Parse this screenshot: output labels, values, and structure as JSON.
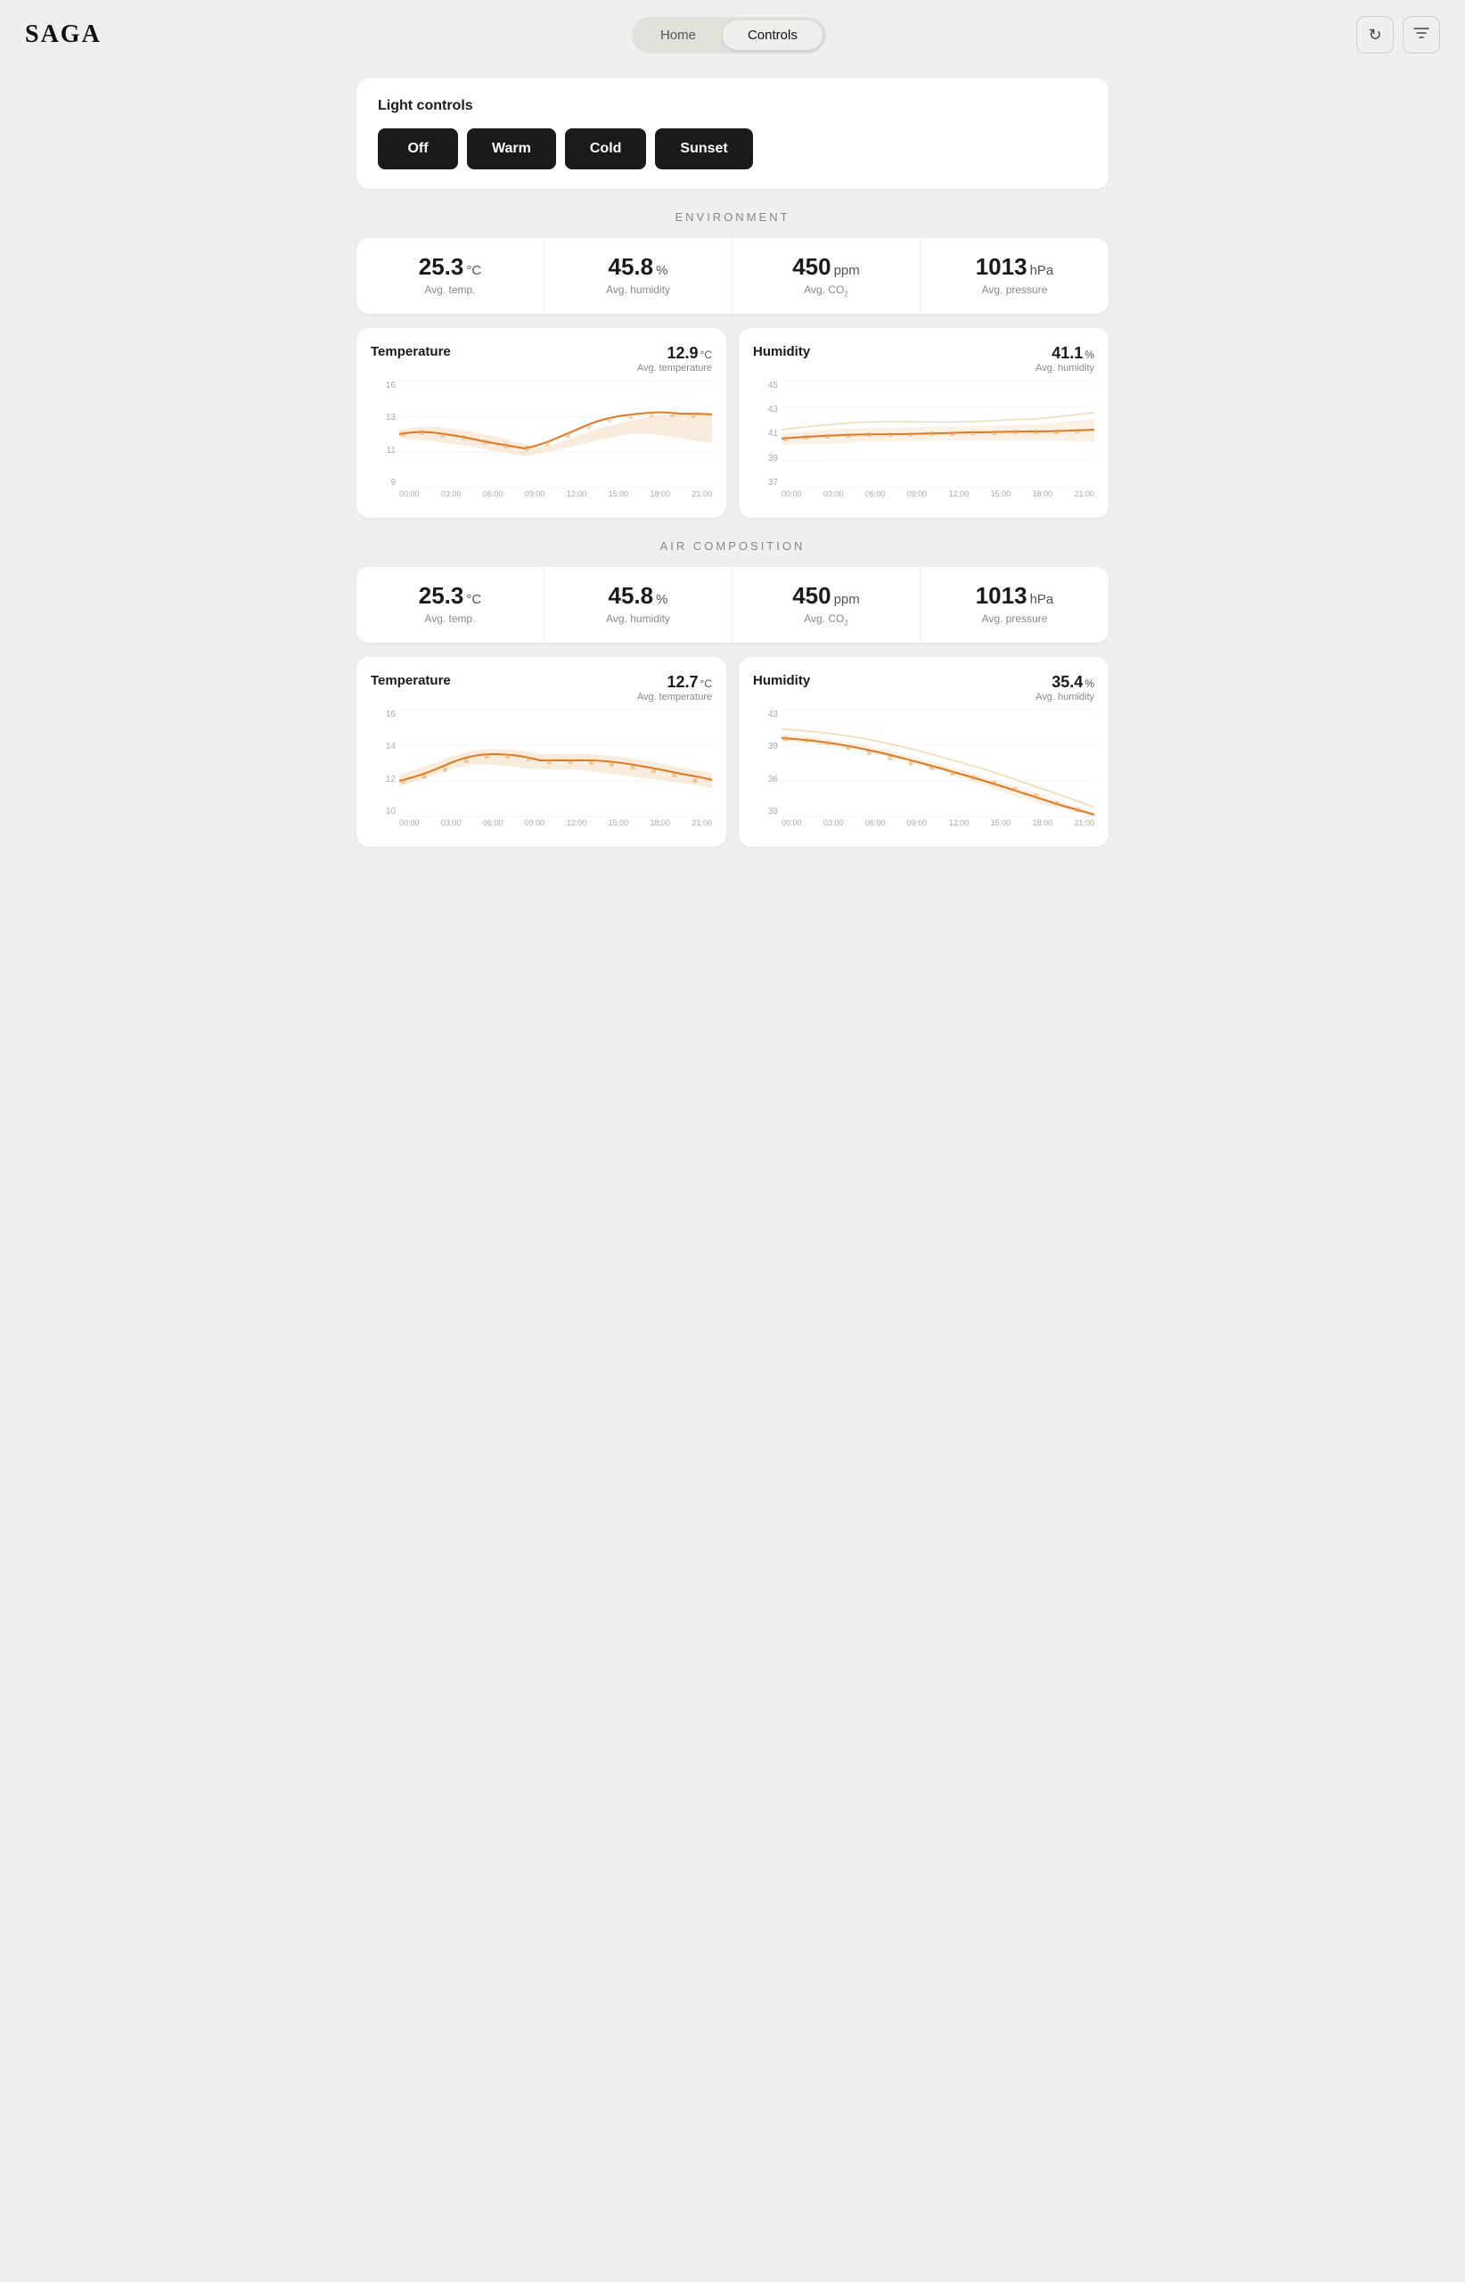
{
  "header": {
    "logo": "SAGA",
    "nav": {
      "home_label": "Home",
      "controls_label": "Controls"
    },
    "icons": {
      "refresh": "↻",
      "filter": "⚙"
    }
  },
  "light_controls": {
    "title": "Light controls",
    "buttons": [
      "Off",
      "Warm",
      "Cold",
      "Sunset"
    ]
  },
  "environment": {
    "section_title": "ENVIRONMENT",
    "stats": [
      {
        "value": "25.3",
        "unit": "°C",
        "label": "Avg. temp."
      },
      {
        "value": "45.8",
        "unit": "%",
        "label": "Avg. humidity"
      },
      {
        "value": "450",
        "unit": "ppm",
        "label": "Avg. CO₂"
      },
      {
        "value": "1013",
        "unit": "hPa",
        "label": "Avg. pressure"
      }
    ],
    "charts": [
      {
        "name": "Temperature",
        "avg_value": "12.9",
        "avg_unit": "°C",
        "avg_label": "Avg. temperature",
        "y_labels": [
          "16",
          "13",
          "11",
          "9"
        ],
        "x_labels": [
          "00:00",
          "03:00",
          "06:00",
          "09:00",
          "12:00",
          "15:00",
          "18:00",
          "21:00"
        ],
        "type": "temperature1"
      },
      {
        "name": "Humidity",
        "avg_value": "41.1",
        "avg_unit": "%",
        "avg_label": "Avg. humidity",
        "y_labels": [
          "45",
          "43",
          "41",
          "39",
          "37"
        ],
        "x_labels": [
          "00:00",
          "03:00",
          "06:00",
          "09:00",
          "12:00",
          "15:00",
          "18:00",
          "21:00"
        ],
        "type": "humidity1"
      }
    ]
  },
  "air_composition": {
    "section_title": "AIR COMPOSITION",
    "stats": [
      {
        "value": "25.3",
        "unit": "°C",
        "label": "Avg. temp."
      },
      {
        "value": "45.8",
        "unit": "%",
        "label": "Avg. humidity"
      },
      {
        "value": "450",
        "unit": "ppm",
        "label": "Avg. CO₂"
      },
      {
        "value": "1013",
        "unit": "hPa",
        "label": "Avg. pressure"
      }
    ],
    "charts": [
      {
        "name": "Temperature",
        "avg_value": "12.7",
        "avg_unit": "°C",
        "avg_label": "Avg. temperature",
        "y_labels": [
          "16",
          "14",
          "12",
          "10"
        ],
        "x_labels": [
          "00:00",
          "03:00",
          "06:00",
          "09:00",
          "12:00",
          "15:00",
          "18:00",
          "21:00"
        ],
        "type": "temperature2"
      },
      {
        "name": "Humidity",
        "avg_value": "35.4",
        "avg_unit": "%",
        "avg_label": "Avg. humidity",
        "y_labels": [
          "43",
          "39",
          "36",
          "33"
        ],
        "x_labels": [
          "00:00",
          "03:00",
          "06:00",
          "09:00",
          "12:00",
          "15:00",
          "18:00",
          "21:00"
        ],
        "type": "humidity2"
      }
    ]
  }
}
